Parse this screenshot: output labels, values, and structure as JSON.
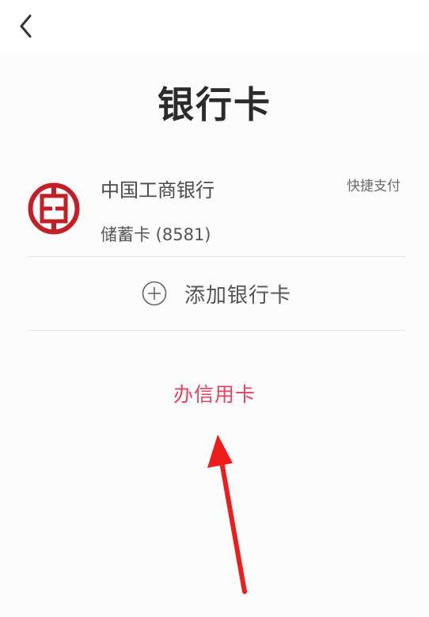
{
  "header": {
    "back_icon": "chevron-left-icon"
  },
  "page": {
    "title": "银行卡"
  },
  "card": {
    "bank_name": "中国工商银行",
    "card_type": "储蓄卡 (8581)",
    "quick_pay_label": "快捷支付",
    "logo_icon": "icbc-logo-icon",
    "logo_color": "#c41e26"
  },
  "add_card": {
    "icon": "plus-circle-icon",
    "label": "添加银行卡"
  },
  "credit": {
    "label": "办信用卡",
    "color": "#e8405e"
  },
  "annotation": {
    "icon": "red-arrow-icon",
    "color": "#ee1c1c"
  }
}
